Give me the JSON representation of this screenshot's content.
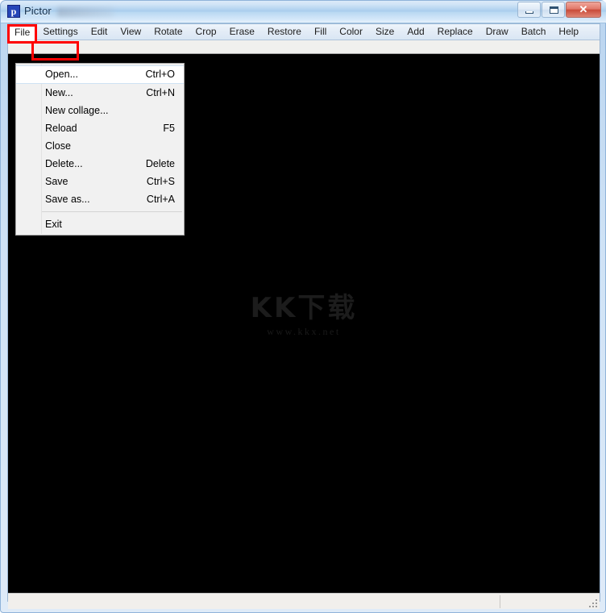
{
  "window": {
    "app_icon": "p",
    "title": "Pictor",
    "title_redacted": true,
    "controls": {
      "minimize": "minimize-icon",
      "maximize": "maximize-icon",
      "close": "✕"
    }
  },
  "menubar": {
    "items": [
      {
        "label": "File",
        "active": true
      },
      {
        "label": "Settings",
        "active": false
      },
      {
        "label": "Edit",
        "active": false
      },
      {
        "label": "View",
        "active": false
      },
      {
        "label": "Rotate",
        "active": false
      },
      {
        "label": "Crop",
        "active": false
      },
      {
        "label": "Erase",
        "active": false
      },
      {
        "label": "Restore",
        "active": false
      },
      {
        "label": "Fill",
        "active": false
      },
      {
        "label": "Color",
        "active": false
      },
      {
        "label": "Size",
        "active": false
      },
      {
        "label": "Add",
        "active": false
      },
      {
        "label": "Replace",
        "active": false
      },
      {
        "label": "Draw",
        "active": false
      },
      {
        "label": "Batch",
        "active": false
      },
      {
        "label": "Help",
        "active": false
      }
    ]
  },
  "dropdown": {
    "owner": "File",
    "items": [
      {
        "label": "Open...",
        "shortcut": "Ctrl+O",
        "highlighted": true,
        "separator_before": false
      },
      {
        "label": "New...",
        "shortcut": "Ctrl+N",
        "highlighted": false,
        "separator_before": false
      },
      {
        "label": "New collage...",
        "shortcut": "",
        "highlighted": false,
        "separator_before": false
      },
      {
        "label": "Reload",
        "shortcut": "F5",
        "highlighted": false,
        "separator_before": false
      },
      {
        "label": "Close",
        "shortcut": "",
        "highlighted": false,
        "separator_before": false
      },
      {
        "label": "Delete...",
        "shortcut": "Delete",
        "highlighted": false,
        "separator_before": false
      },
      {
        "label": "Save",
        "shortcut": "Ctrl+S",
        "highlighted": false,
        "separator_before": false
      },
      {
        "label": "Save as...",
        "shortcut": "Ctrl+A",
        "highlighted": false,
        "separator_before": false
      },
      {
        "label": "Exit",
        "shortcut": "",
        "highlighted": false,
        "separator_before": true
      }
    ]
  },
  "canvas": {
    "background_color": "#000000",
    "watermark_main": "KK下载",
    "watermark_sub": "www.kkx.net"
  },
  "statusbar": {
    "left_text": "",
    "right_text": ""
  },
  "annotations": {
    "accent_color": "#ff0000",
    "boxes": [
      {
        "target": "File",
        "label": "file-menu-highlight"
      },
      {
        "target": "Open...",
        "label": "open-item-highlight"
      }
    ]
  }
}
